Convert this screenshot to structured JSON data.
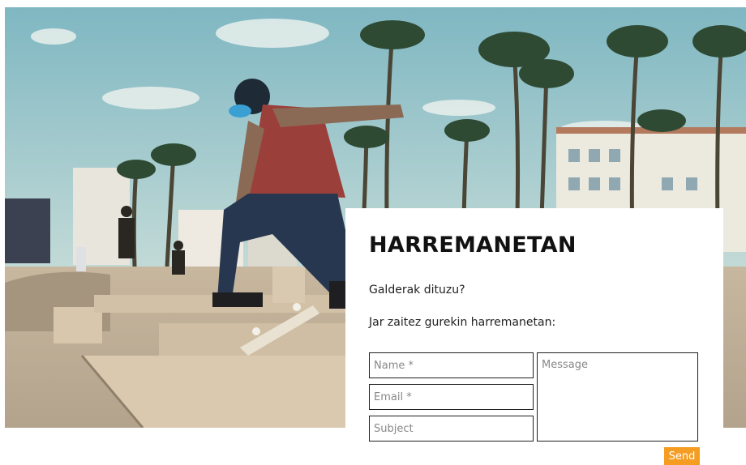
{
  "hero": {
    "image_description": "skateboarder-jumping-at-venice-skatepark"
  },
  "contact": {
    "title": "HARREMANETAN",
    "question": "Galderak dituzu?",
    "prompt": "Jar zaitez gurekin harremanetan:",
    "name_placeholder": "Name *",
    "email_placeholder": "Email *",
    "subject_placeholder": "Subject",
    "message_placeholder": "Message",
    "send_label": "Send"
  },
  "colors": {
    "accent": "#f59d23",
    "sky": "#a9cfd3",
    "concrete": "#cdbca4"
  }
}
